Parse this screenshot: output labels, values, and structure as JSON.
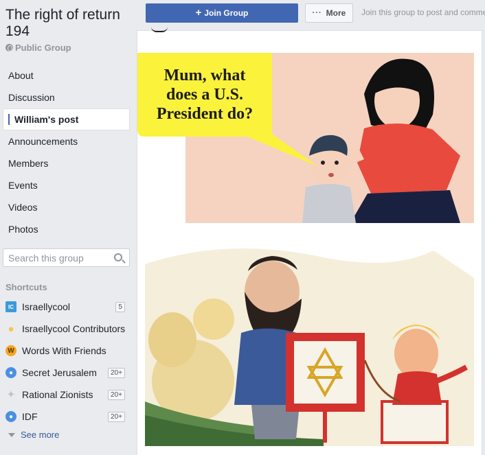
{
  "group": {
    "title": "The right of return 194",
    "type_label": "Public Group"
  },
  "nav": {
    "items": [
      {
        "label": "About",
        "active": false
      },
      {
        "label": "Discussion",
        "active": false
      },
      {
        "label": "William's post",
        "active": true
      },
      {
        "label": "Announcements",
        "active": false
      },
      {
        "label": "Members",
        "active": false
      },
      {
        "label": "Events",
        "active": false
      },
      {
        "label": "Videos",
        "active": false
      },
      {
        "label": "Photos",
        "active": false
      }
    ]
  },
  "search": {
    "placeholder": "Search this group",
    "value": ""
  },
  "shortcuts": {
    "header": "Shortcuts",
    "items": [
      {
        "label": "Israellycool",
        "icon": "israellycool-icon",
        "badge": "5"
      },
      {
        "label": "Israellycool Contributors",
        "icon": "lightbulb-icon",
        "badge": ""
      },
      {
        "label": "Words With Friends",
        "icon": "words-with-friends-icon",
        "badge": ""
      },
      {
        "label": "Secret Jerusalem",
        "icon": "group-icon",
        "badge": "20+"
      },
      {
        "label": "Rational Zionists",
        "icon": "bird-icon",
        "badge": "20+"
      },
      {
        "label": "IDF",
        "icon": "group-icon",
        "badge": "20+"
      }
    ],
    "see_more": "See more"
  },
  "toolbar": {
    "join_label": "Join Group",
    "more_label": "More",
    "join_hint": "Join this group to post and comment."
  },
  "post": {
    "comic_speech_lines": [
      "Mum, what",
      "does a U.S.",
      "President do?"
    ]
  },
  "colors": {
    "brand": "#4267b2",
    "sidebar_bg": "#e9ebee",
    "speech_bubble": "#fbf23c"
  }
}
